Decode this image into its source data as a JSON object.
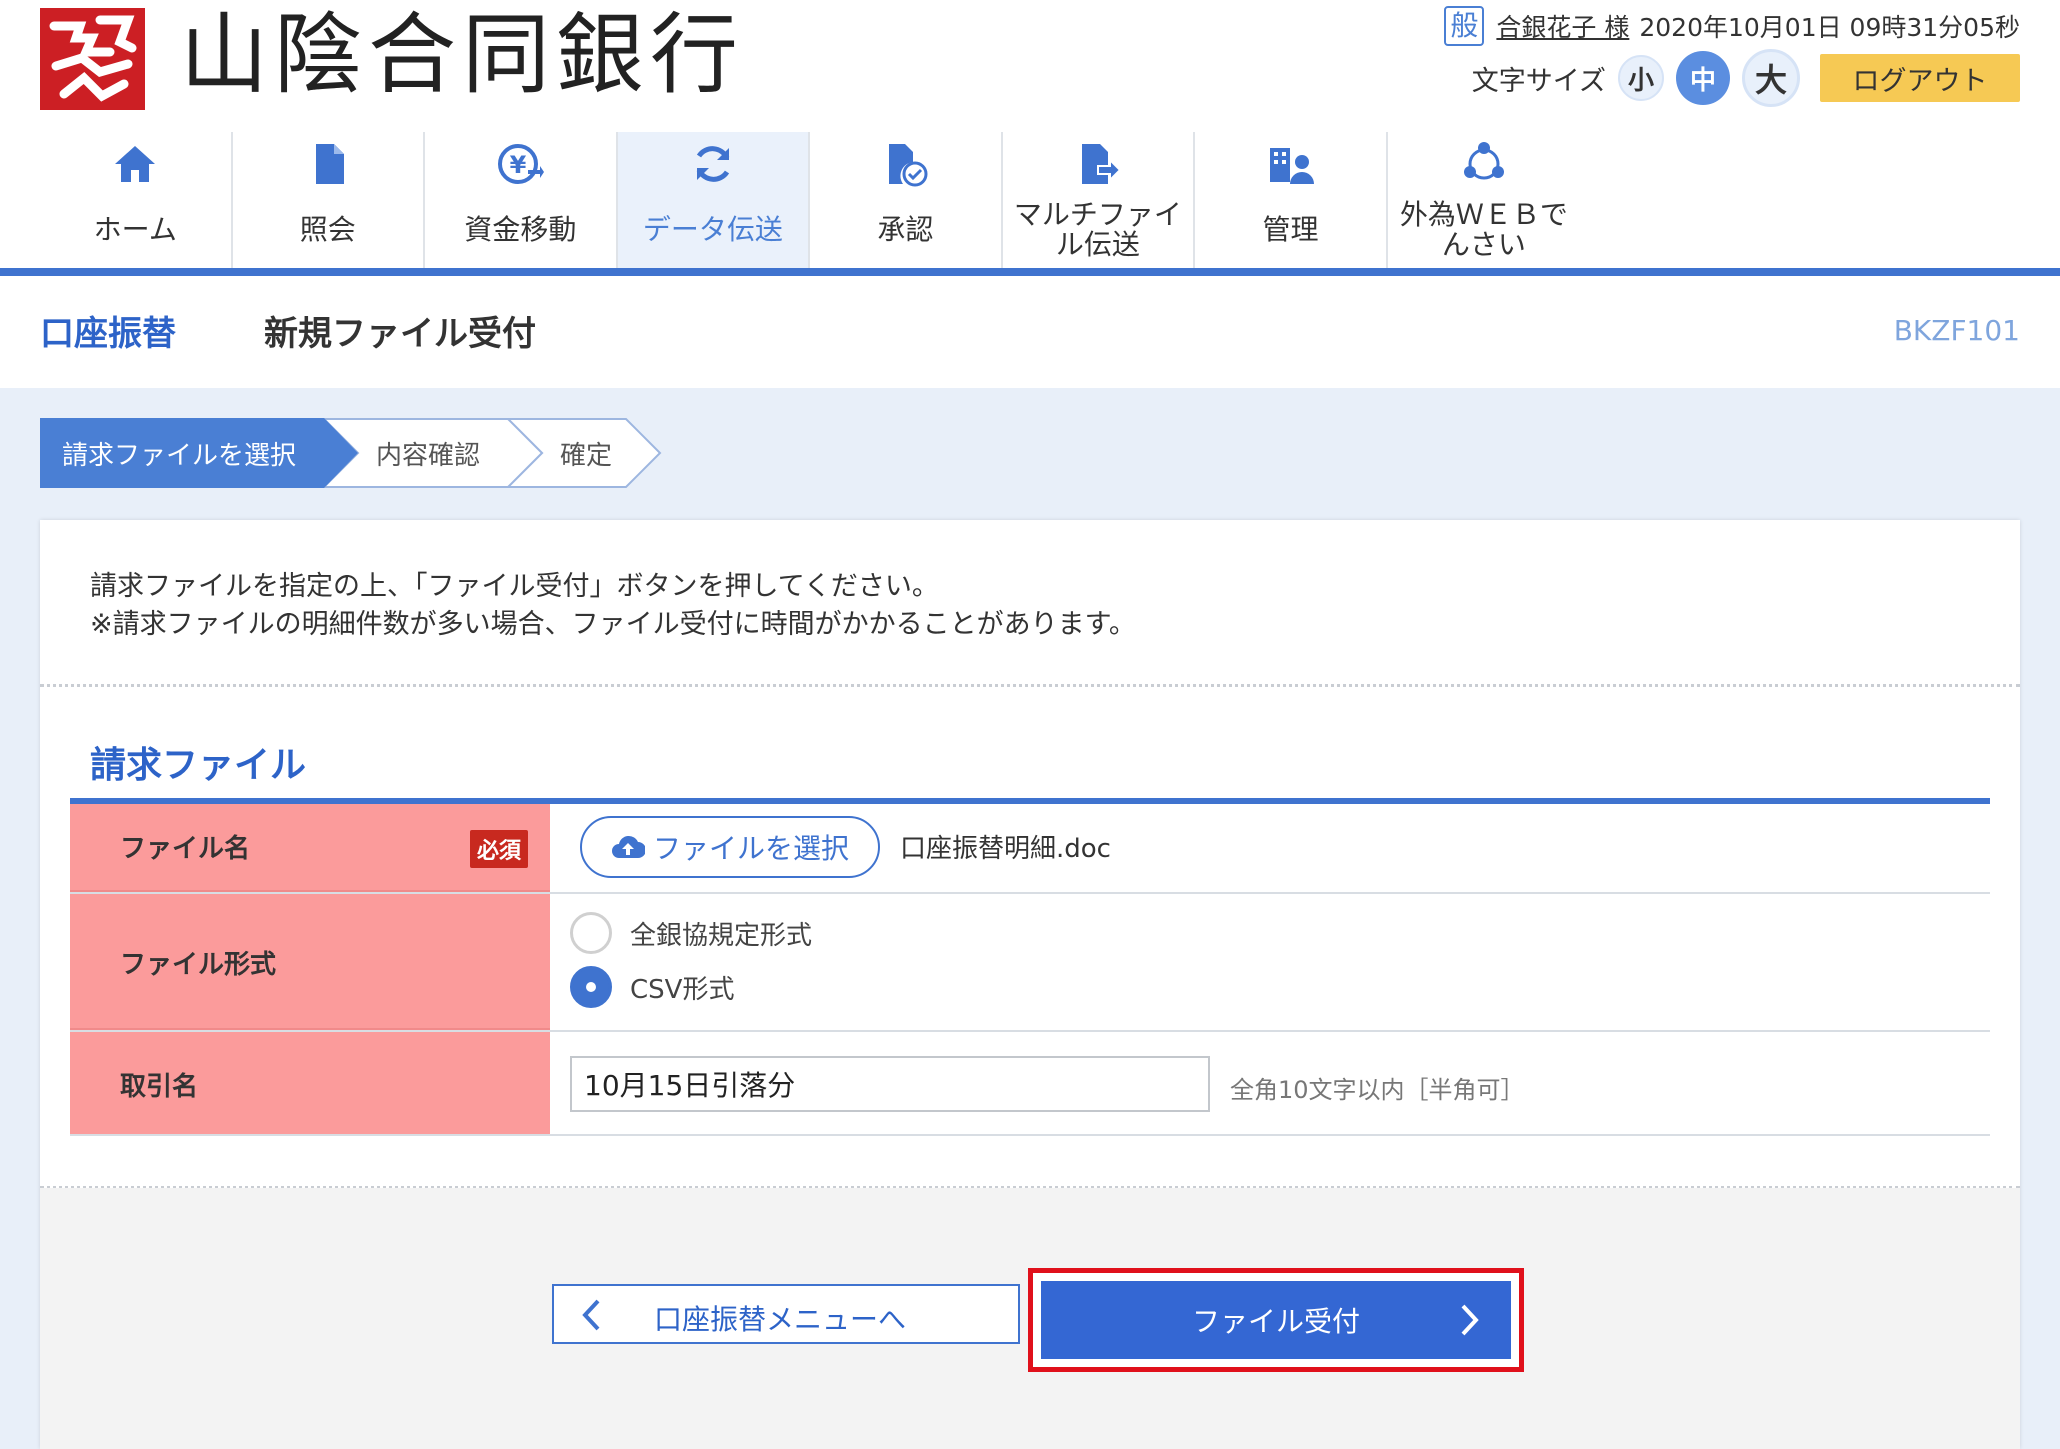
{
  "header": {
    "bank_name": "山陰合同銀行",
    "user_badge": "般",
    "user_name": "合銀花子 様",
    "datetime": "2020年10月01日 09時31分05秒",
    "font_size_label": "文字サイズ",
    "size_small": "小",
    "size_mid": "中",
    "size_large": "大",
    "logout": "ログアウト",
    "brand_color": "#cc1f24"
  },
  "nav": {
    "items": [
      {
        "label": "ホーム",
        "icon": "home-icon"
      },
      {
        "label": "照会",
        "icon": "document-icon"
      },
      {
        "label": "資金移動",
        "icon": "yen-transfer-icon"
      },
      {
        "label": "データ伝送",
        "icon": "sync-icon",
        "active": true
      },
      {
        "label": "承認",
        "icon": "approve-icon"
      },
      {
        "label": "マルチファイル伝送",
        "icon": "multi-file-icon"
      },
      {
        "label": "管理",
        "icon": "admin-icon"
      },
      {
        "label": "外為ＷＥＢでんさい",
        "icon": "network-icon"
      }
    ],
    "accent_color": "#3f73cf"
  },
  "title": {
    "category": "口座振替",
    "page_title": "新規ファイル受付",
    "screen_code": "BKZF101"
  },
  "steps": [
    {
      "label": "請求ファイルを選択",
      "active": true
    },
    {
      "label": "内容確認",
      "active": false
    },
    {
      "label": "確定",
      "active": false
    }
  ],
  "instructions": {
    "line1": "請求ファイルを指定の上、「ファイル受付」ボタンを押してください。",
    "line2": "※請求ファイルの明細件数が多い場合、ファイル受付に時間がかかることがあります。"
  },
  "form": {
    "section_title": "請求ファイル",
    "file_name_label": "ファイル名",
    "required_badge": "必須",
    "file_select_button": "ファイルを選択",
    "selected_file": "口座振替明細.doc",
    "file_format_label": "ファイル形式",
    "format_options": [
      {
        "label": "全銀協規定形式",
        "checked": false
      },
      {
        "label": "CSV形式",
        "checked": true
      }
    ],
    "transaction_label": "取引名",
    "transaction_value": "10月15日引落分",
    "transaction_hint": "全角10文字以内［半角可］"
  },
  "buttons": {
    "back": "口座振替メニューへ",
    "submit": "ファイル受付"
  }
}
